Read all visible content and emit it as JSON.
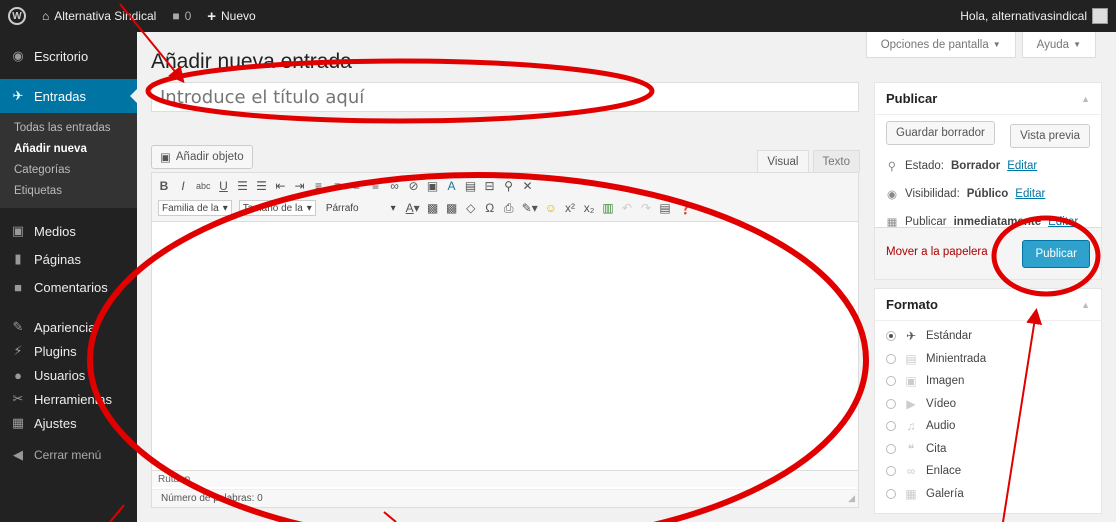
{
  "adminbar": {
    "site_name": "Alternativa Sindical",
    "comments_count": "0",
    "new_label": "Nuevo",
    "greeting": "Hola, alternativasindical"
  },
  "sidebar": {
    "items": [
      {
        "label": "Escritorio",
        "icon": "dashboard-icon"
      },
      {
        "label": "Entradas",
        "icon": "pin-icon"
      },
      {
        "label": "Medios",
        "icon": "media-icon"
      },
      {
        "label": "Páginas",
        "icon": "page-icon"
      },
      {
        "label": "Comentarios",
        "icon": "comment-icon"
      },
      {
        "label": "Apariencia",
        "icon": "brush-icon"
      },
      {
        "label": "Plugins",
        "icon": "plugin-icon"
      },
      {
        "label": "Usuarios",
        "icon": "users-icon"
      },
      {
        "label": "Herramientas",
        "icon": "wrench-icon"
      },
      {
        "label": "Ajustes",
        "icon": "settings-icon"
      }
    ],
    "submenu": [
      "Todas las entradas",
      "Añadir nueva",
      "Categorías",
      "Etiquetas"
    ],
    "collapse_label": "Cerrar menú"
  },
  "screen_options": {
    "options": "Opciones de pantalla",
    "help": "Ayuda"
  },
  "page": {
    "title": "Añadir nueva entrada",
    "title_placeholder": "Introduce el título aquí"
  },
  "editor": {
    "add_media": "Añadir objeto",
    "tab_visual": "Visual",
    "tab_text": "Texto",
    "font_family": "Familia de la",
    "font_size": "Tamaño de la",
    "format": "Párrafo",
    "path_label": "Ruta: p",
    "word_count": "Número de palabras: 0"
  },
  "publish": {
    "title": "Publicar",
    "save_draft": "Guardar borrador",
    "preview": "Vista previa",
    "status_label": "Estado:",
    "status_value": "Borrador",
    "visibility_label": "Visibilidad:",
    "visibility_value": "Público",
    "schedule_label": "Publicar",
    "schedule_value": "inmediatamente",
    "edit": "Editar",
    "trash": "Mover a la papelera",
    "publish_button": "Publicar"
  },
  "format_box": {
    "title": "Formato",
    "options": [
      "Estándar",
      "Minientrada",
      "Imagen",
      "Vídeo",
      "Audio",
      "Cita",
      "Enlace",
      "Galería"
    ]
  },
  "colors": {
    "accent": "#0074a2",
    "annotation": "#e00000",
    "publish": "#2ea2cc"
  }
}
